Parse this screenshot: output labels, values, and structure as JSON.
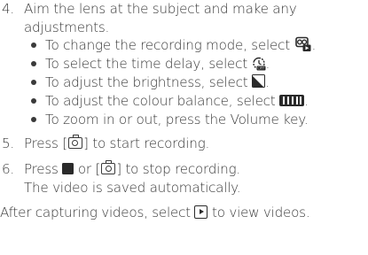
{
  "steps": [
    {
      "number": "4.",
      "lines": [
        "Aim the lens at the subject and make any",
        "adjustments."
      ],
      "bullets": [
        {
          "text": "To change the recording mode, select",
          "icon": "recording-mode-icon",
          "suffix": "."
        },
        {
          "text": "To select the time delay, select",
          "icon": "timer-icon",
          "suffix": "."
        },
        {
          "text": "To adjust the brightness, select",
          "icon": "brightness-icon",
          "suffix": "."
        },
        {
          "text": "To adjust the colour balance, select",
          "icon": "white-balance-icon",
          "suffix": "."
        },
        {
          "text": "To zoom in or out, press the Volume key.",
          "icon": "",
          "suffix": ""
        }
      ]
    },
    {
      "number": "5.",
      "before": "Press [",
      "after": "] to start recording.",
      "icon": "camera-key-icon"
    },
    {
      "number": "6.",
      "before": "Press",
      "middle": "or [",
      "after": "] to stop recording.",
      "second_line": "The video is saved automatically.",
      "icons": [
        "stop-icon",
        "camera-key-icon"
      ]
    }
  ],
  "footer": {
    "before": "After capturing videos, select",
    "after": "to view videos.",
    "icon": "play-icon"
  },
  "colors": {
    "text": "#3a3a3a",
    "icon": "#2a2a2a"
  }
}
